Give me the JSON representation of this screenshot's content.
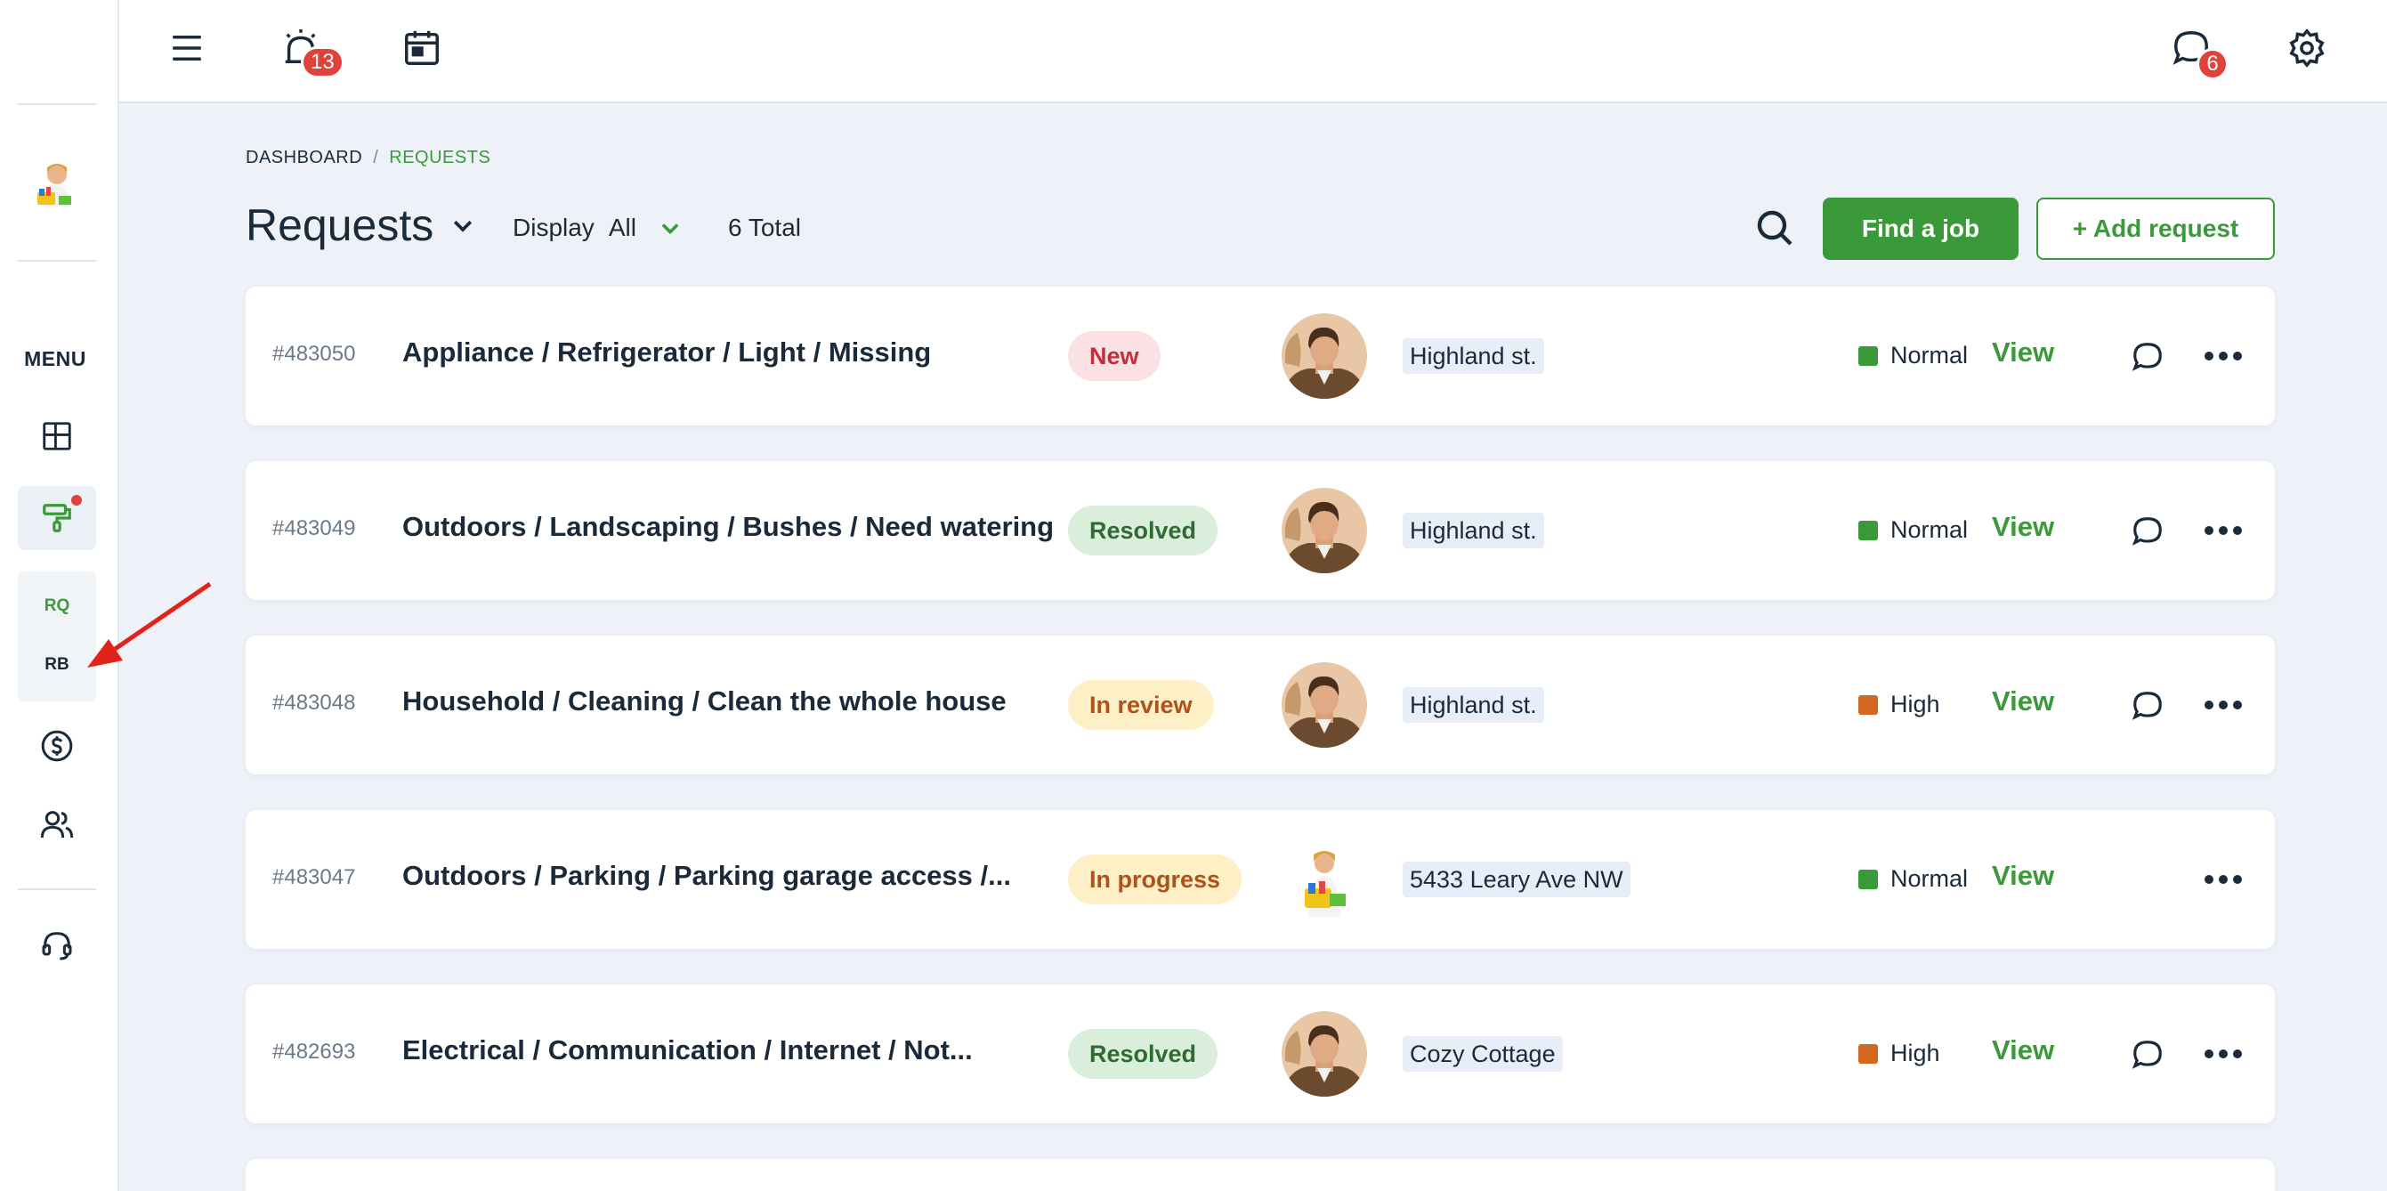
{
  "topbar": {
    "alarm_badge": "13",
    "chat_badge": "6"
  },
  "sidebar": {
    "menu_label": "MENU",
    "sub_items": [
      "RQ",
      "RB"
    ]
  },
  "breadcrumb": {
    "items": [
      "DASHBOARD",
      "REQUESTS"
    ],
    "separator": "/"
  },
  "header": {
    "title": "Requests",
    "display_label": "Display",
    "display_value": "All",
    "total": "6 Total",
    "find_button": "Find a job",
    "add_button": "+ Add request"
  },
  "colors": {
    "accent": "#3a9a3a",
    "priority_normal": "#3a9a3a",
    "priority_high": "#d2691e",
    "badge_red": "#e0413a"
  },
  "rows": [
    {
      "id": "#483050",
      "title": "Appliance / Refrigerator / Light / Missing",
      "status": "New",
      "status_type": "new",
      "avatar": "man",
      "property": "Highland st.",
      "priority": "Normal",
      "priority_type": "normal",
      "view": "View",
      "has_chat": true
    },
    {
      "id": "#483049",
      "title": "Outdoors / Landscaping / Bushes / Need watering",
      "status": "Resolved",
      "status_type": "resolved",
      "avatar": "man",
      "property": "Highland st.",
      "priority": "Normal",
      "priority_type": "normal",
      "view": "View",
      "has_chat": true
    },
    {
      "id": "#483048",
      "title": "Household / Cleaning / Clean the whole house",
      "status": "In review",
      "status_type": "review",
      "avatar": "man",
      "property": "Highland st.",
      "priority": "High",
      "priority_type": "high",
      "view": "View",
      "has_chat": true
    },
    {
      "id": "#483047",
      "title": "Outdoors / Parking / Parking garage access /...",
      "status": "In progress",
      "status_type": "progress",
      "avatar": "cleaner",
      "property": "5433 Leary Ave NW",
      "priority": "Normal",
      "priority_type": "normal",
      "view": "View",
      "has_chat": false
    },
    {
      "id": "#482693",
      "title": "Electrical / Communication / Internet / Not...",
      "status": "Resolved",
      "status_type": "resolved",
      "avatar": "man",
      "property": "Cozy Cottage",
      "priority": "High",
      "priority_type": "high",
      "view": "View",
      "has_chat": true
    }
  ]
}
